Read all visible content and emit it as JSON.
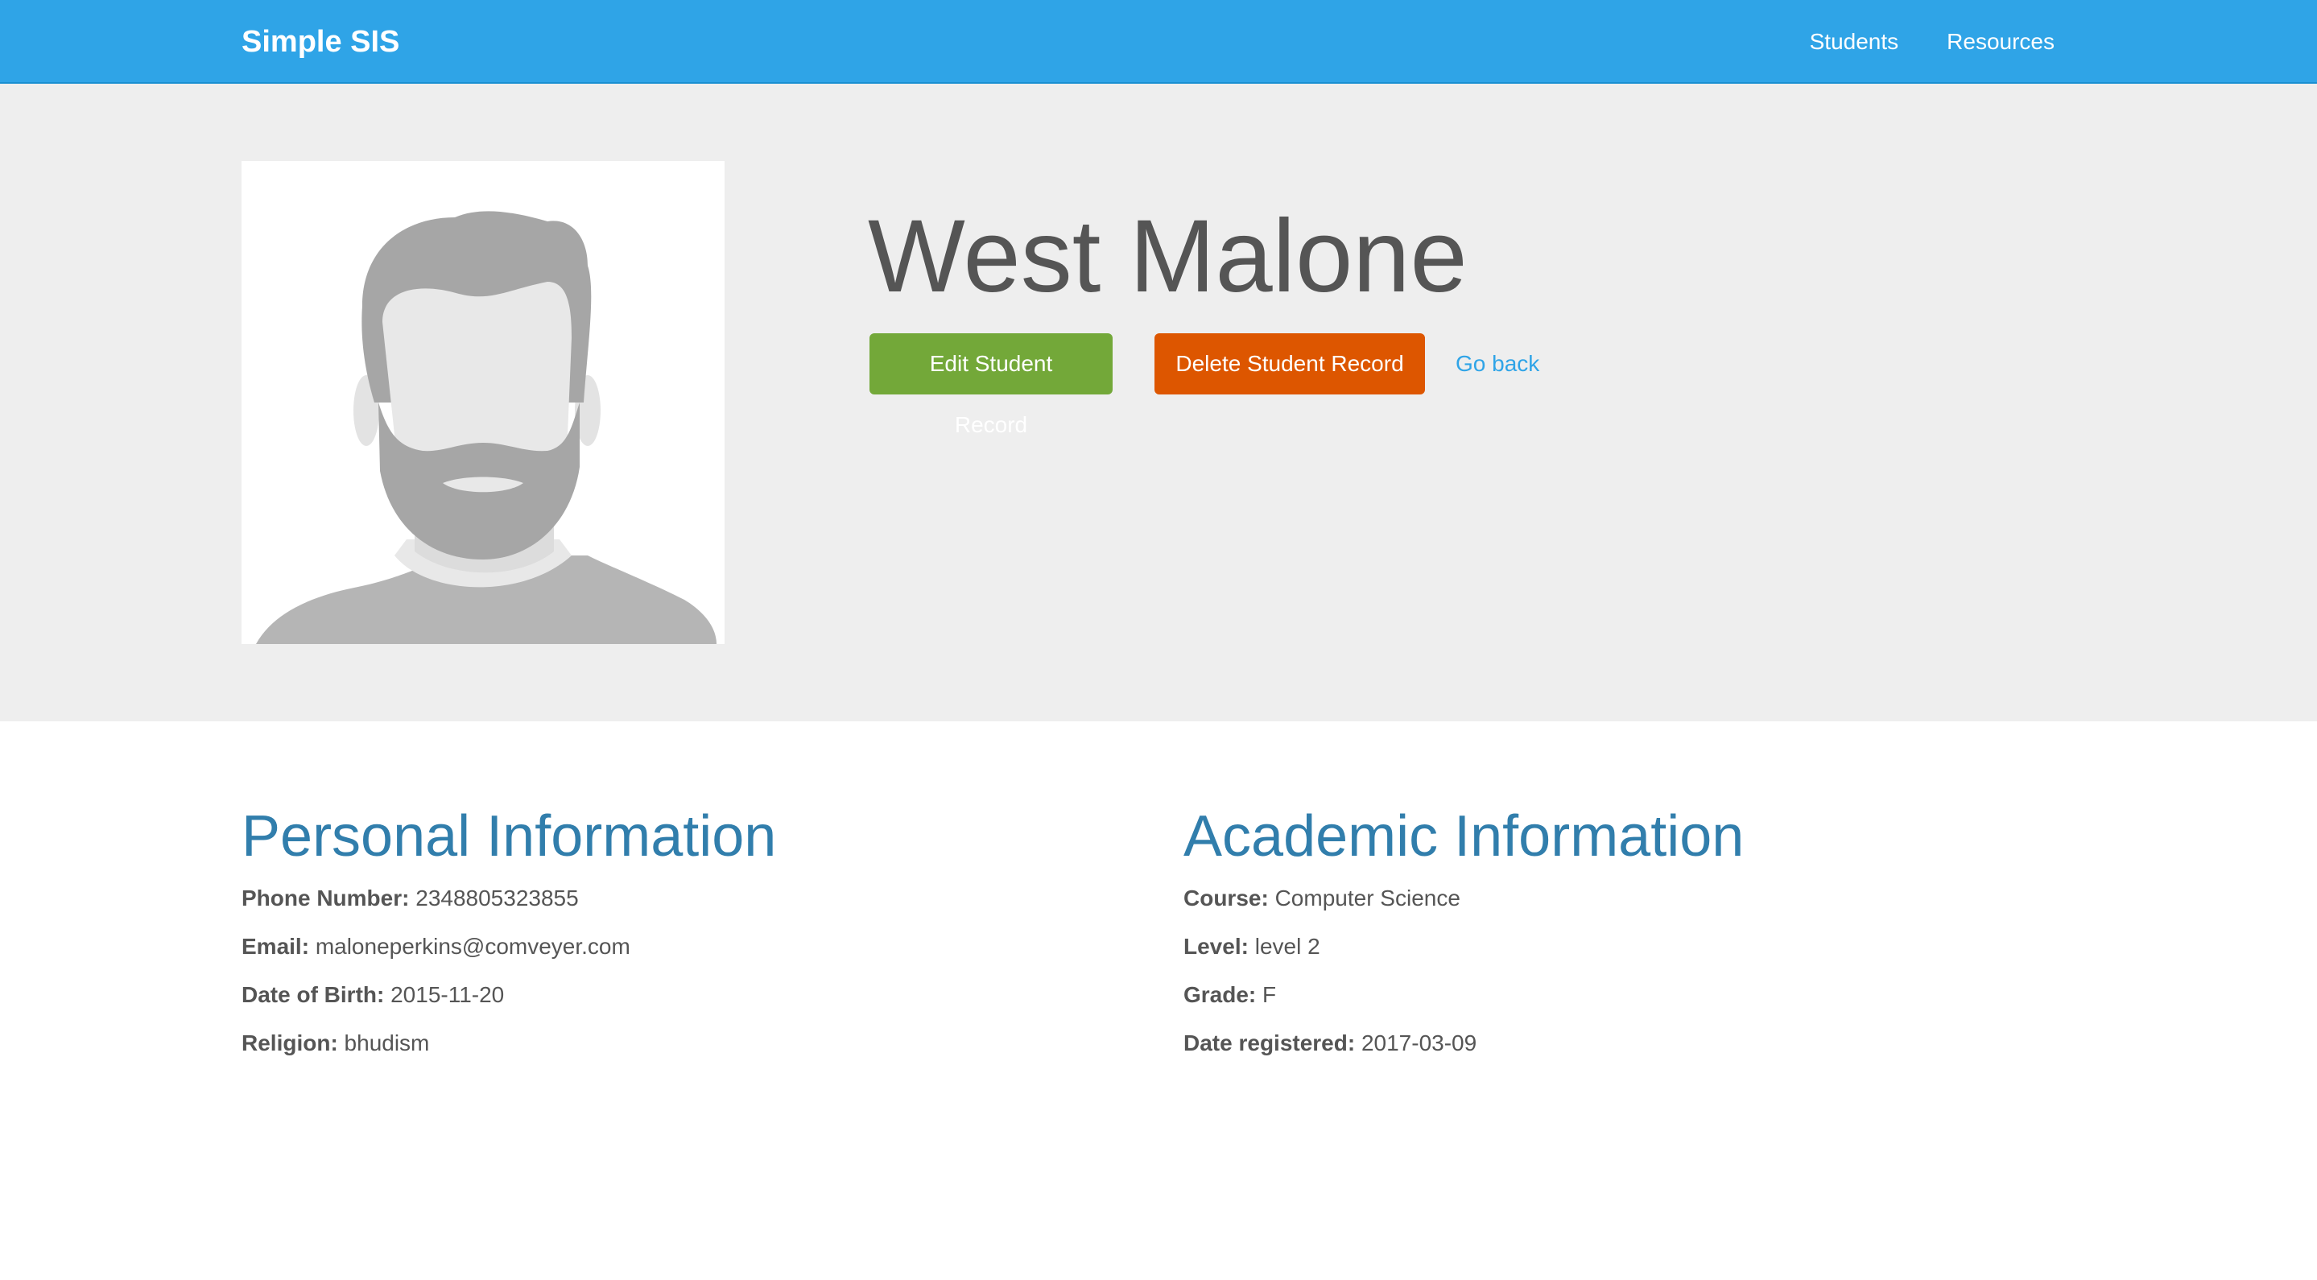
{
  "navbar": {
    "brand": "Simple SIS",
    "links": [
      {
        "label": "Students"
      },
      {
        "label": "Resources"
      }
    ]
  },
  "profile": {
    "name": "West Malone",
    "avatar_icon": "person-placeholder-icon",
    "edit_label": "Edit Student Record",
    "delete_label": "Delete Student Record",
    "back_label": "Go back"
  },
  "personal": {
    "title": "Personal Information",
    "fields": [
      {
        "label": "Phone Number:",
        "value": "2348805323855"
      },
      {
        "label": "Email:",
        "value": "maloneperkins@comveyer.com"
      },
      {
        "label": "Date of Birth:",
        "value": "2015-11-20"
      },
      {
        "label": "Religion:",
        "value": "bhudism"
      }
    ]
  },
  "academic": {
    "title": "Academic Information",
    "fields": [
      {
        "label": "Course:",
        "value": "Computer Science"
      },
      {
        "label": "Level:",
        "value": "level 2"
      },
      {
        "label": "Grade:",
        "value": "F"
      },
      {
        "label": "Date registered:",
        "value": "2017-03-09"
      }
    ]
  },
  "colors": {
    "navbar": "#2fa4e7",
    "edit": "#73a839",
    "delete": "#dd5600",
    "heading": "#317eac",
    "jumbotron": "#eeeeee"
  }
}
